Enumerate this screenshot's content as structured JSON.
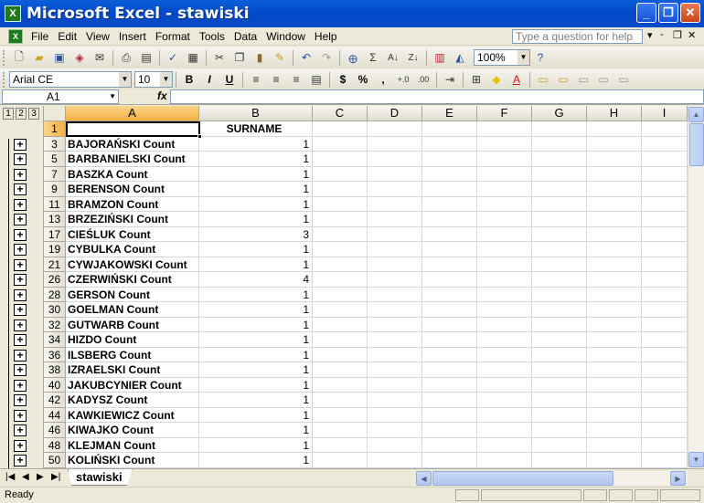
{
  "window": {
    "title": "Microsoft Excel - stawiski",
    "app_icon": "X",
    "min": "_",
    "max": "❐",
    "close": "✕"
  },
  "menu": {
    "doc_icon": "X",
    "items": [
      "File",
      "Edit",
      "View",
      "Insert",
      "Format",
      "Tools",
      "Data",
      "Window",
      "Help"
    ],
    "help_placeholder": "Type a question for help",
    "min": "-",
    "restore": "❐",
    "close": "✕"
  },
  "toolbar": {
    "zoom": "100%"
  },
  "format_toolbar": {
    "font": "Arial CE",
    "size": "10"
  },
  "namebox": {
    "value": "A1"
  },
  "formula": {
    "fx": "fx",
    "value": ""
  },
  "outline": {
    "levels": [
      "1",
      "2",
      "3"
    ]
  },
  "columns": [
    "A",
    "B",
    "C",
    "D",
    "E",
    "F",
    "G",
    "H",
    "I"
  ],
  "header_row": {
    "row": "1",
    "a": "",
    "b": "SURNAME"
  },
  "rows": [
    {
      "row": "3",
      "a": "BAJORAŃSKI Count",
      "b": "1"
    },
    {
      "row": "5",
      "a": "BARBANIELSKI Count",
      "b": "1"
    },
    {
      "row": "7",
      "a": "BASZKA Count",
      "b": "1"
    },
    {
      "row": "9",
      "a": "BERENSON Count",
      "b": "1"
    },
    {
      "row": "11",
      "a": "BRAMZON Count",
      "b": "1"
    },
    {
      "row": "13",
      "a": "BRZEZIŃSKI Count",
      "b": "1"
    },
    {
      "row": "17",
      "a": "CIEŚLUK Count",
      "b": "3"
    },
    {
      "row": "19",
      "a": "CYBULKA Count",
      "b": "1"
    },
    {
      "row": "21",
      "a": "CYWJAKOWSKI Count",
      "b": "1"
    },
    {
      "row": "26",
      "a": "CZERWIŃSKI Count",
      "b": "4"
    },
    {
      "row": "28",
      "a": "GERSON Count",
      "b": "1"
    },
    {
      "row": "30",
      "a": "GOELMAN Count",
      "b": "1"
    },
    {
      "row": "32",
      "a": "GUTWARB Count",
      "b": "1"
    },
    {
      "row": "34",
      "a": "HIZDO Count",
      "b": "1"
    },
    {
      "row": "36",
      "a": "ILSBERG Count",
      "b": "1"
    },
    {
      "row": "38",
      "a": "IZRAELSKI Count",
      "b": "1"
    },
    {
      "row": "40",
      "a": "JAKUBCYNIER Count",
      "b": "1"
    },
    {
      "row": "42",
      "a": "KADYSZ Count",
      "b": "1"
    },
    {
      "row": "44",
      "a": "KAWKIEWICZ Count",
      "b": "1"
    },
    {
      "row": "46",
      "a": "KIWAJKO Count",
      "b": "1"
    },
    {
      "row": "48",
      "a": "KLEJMAN Count",
      "b": "1"
    },
    {
      "row": "50",
      "a": "KOLIŃSKI Count",
      "b": "1"
    }
  ],
  "sheet_tab": "stawiski",
  "status": "Ready"
}
